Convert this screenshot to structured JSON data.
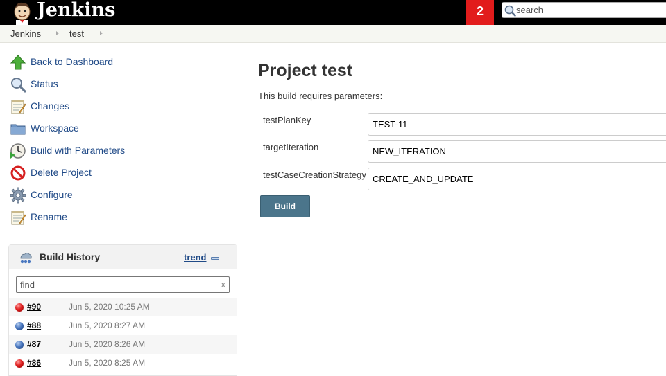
{
  "header": {
    "brand": "Jenkins",
    "notification_count": "2",
    "search_placeholder": "search"
  },
  "breadcrumb": [
    {
      "label": "Jenkins"
    },
    {
      "label": "test"
    }
  ],
  "tasks": [
    {
      "label": "Back to Dashboard",
      "icon": "up-arrow-icon"
    },
    {
      "label": "Status",
      "icon": "magnifier-icon"
    },
    {
      "label": "Changes",
      "icon": "notepad-icon"
    },
    {
      "label": "Workspace",
      "icon": "folder-icon"
    },
    {
      "label": "Build with Parameters",
      "icon": "clock-icon"
    },
    {
      "label": "Delete Project",
      "icon": "no-entry-icon"
    },
    {
      "label": "Configure",
      "icon": "gear-icon"
    },
    {
      "label": "Rename",
      "icon": "notepad-icon"
    }
  ],
  "build_history": {
    "title": "Build History",
    "trend_label": "trend",
    "find_placeholder": "find",
    "clear_label": "x",
    "builds": [
      {
        "number": "#90",
        "date": "Jun 5, 2020 10:25 AM",
        "status": "red"
      },
      {
        "number": "#88",
        "date": "Jun 5, 2020 8:27 AM",
        "status": "blue"
      },
      {
        "number": "#87",
        "date": "Jun 5, 2020 8:26 AM",
        "status": "blue"
      },
      {
        "number": "#86",
        "date": "Jun 5, 2020 8:25 AM",
        "status": "red"
      }
    ]
  },
  "main": {
    "title": "Project test",
    "description": "This build requires parameters:",
    "parameters": [
      {
        "name": "testPlanKey",
        "value": "TEST-11"
      },
      {
        "name": "targetIteration",
        "value": "NEW_ITERATION"
      },
      {
        "name": "testCaseCreationStrategy",
        "value": "CREATE_AND_UPDATE"
      }
    ],
    "build_label": "Build"
  },
  "colors": {
    "header_bg": "#000000",
    "notification_bg": "#e21c1c",
    "link": "#204a87",
    "build_button": "#4b758b"
  }
}
